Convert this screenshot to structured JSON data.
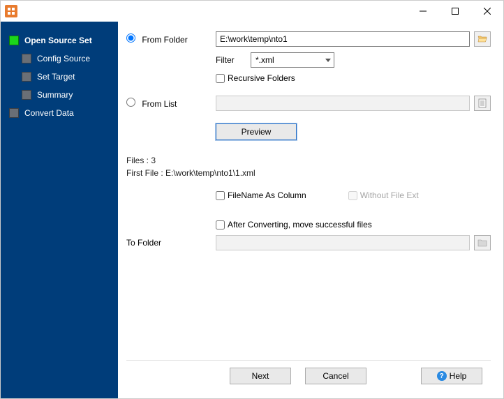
{
  "titlebar": {
    "title": ""
  },
  "sidebar": {
    "items": [
      {
        "label": "Open Source Set",
        "active": true
      },
      {
        "label": "Config Source"
      },
      {
        "label": "Set Target"
      },
      {
        "label": "Summary"
      },
      {
        "label": "Convert Data"
      }
    ]
  },
  "form": {
    "from_folder_label": "From Folder",
    "from_folder_value": "E:\\work\\temp\\nto1",
    "filter_label": "Filter",
    "filter_value": "*.xml",
    "recursive_label": "Recursive Folders",
    "from_list_label": "From List",
    "from_list_value": "",
    "preview_label": "Preview",
    "files_count_label": "Files : 3",
    "first_file_label": "First File : E:\\work\\temp\\nto1\\1.xml",
    "filename_as_column_label": "FileName As Column",
    "without_file_ext_label": "Without File Ext",
    "after_converting_label": "After Converting, move successful files",
    "to_folder_label": "To Folder",
    "to_folder_value": ""
  },
  "footer": {
    "next": "Next",
    "cancel": "Cancel",
    "help": "Help"
  }
}
